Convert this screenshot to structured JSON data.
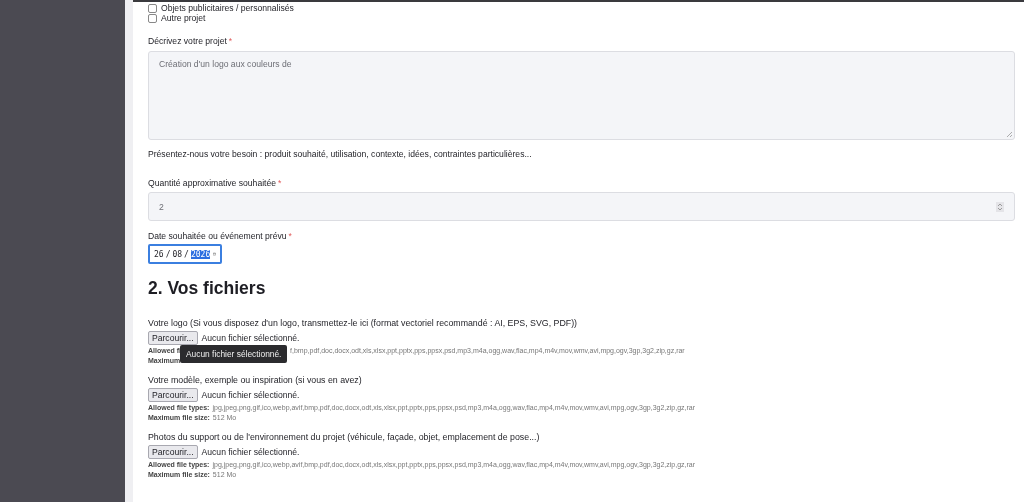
{
  "checkboxes": [
    {
      "label": "Objets publicitaires / personnalisés",
      "checked": false
    },
    {
      "label": "Autre projet",
      "checked": false
    }
  ],
  "description": {
    "label": "Décrivez votre projet",
    "required_mark": "*",
    "value": "Création d'un logo aux couleurs de",
    "help": "Présentez-nous votre besoin : produit souhaité, utilisation, contexte, idées, contraintes particulières..."
  },
  "quantity": {
    "label": "Quantité approximative souhaitée",
    "required_mark": "*",
    "value": "2"
  },
  "date": {
    "label": "Date souhaitée ou événement prévu",
    "required_mark": "*",
    "focused": true,
    "separator": "/",
    "segments": [
      {
        "text": "26",
        "selected": false
      },
      {
        "text": "08",
        "selected": false
      },
      {
        "text": "2026",
        "selected": true
      }
    ]
  },
  "section_title": "2. Vos fichiers",
  "uploads": [
    {
      "label": "Votre logo (Si vous disposez d'un logo, transmettez-le ici (format vectoriel recommandé : AI, EPS, SVG, PDF))",
      "button": "Parcourir...",
      "status": "Aucun fichier sélectionné.",
      "types_label": "Allowed fi",
      "types": "f,bmp,pdf,doc,docx,odt,xls,xlsx,ppt,pptx,pps,ppsx,psd,mp3,m4a,ogg,wav,flac,mp4,m4v,mov,wmv,avi,mpg,ogv,3gp,3g2,zip,gz,rar",
      "size_label": "Maximum",
      "tooltip": "Aucun fichier sélectionné."
    },
    {
      "label": "Votre modèle, exemple ou inspiration (si vous en avez)",
      "button": "Parcourir...",
      "status": "Aucun fichier sélectionné.",
      "types_label": "Allowed file types:",
      "types": "jpg,jpeg,png,gif,ico,webp,avif,bmp,pdf,doc,docx,odt,xls,xlsx,ppt,pptx,pps,ppsx,psd,mp3,m4a,ogg,wav,flac,mp4,m4v,mov,wmv,avi,mpg,ogv,3gp,3g2,zip,gz,rar",
      "size_label": "Maximum file size:",
      "size": "512 Mo"
    },
    {
      "label": "Photos du support ou de l'environnement du projet (véhicule, façade, objet, emplacement de pose...)",
      "button": "Parcourir...",
      "status": "Aucun fichier sélectionné.",
      "types_label": "Allowed file types:",
      "types": "jpg,jpeg,png,gif,ico,webp,avif,bmp,pdf,doc,docx,odt,xls,xlsx,ppt,pptx,pps,ppsx,psd,mp3,m4a,ogg,wav,flac,mp4,m4v,mov,wmv,avi,mpg,ogv,3gp,3g2,zip,gz,rar",
      "size_label": "Maximum file size:",
      "size": "512 Mo"
    }
  ]
}
